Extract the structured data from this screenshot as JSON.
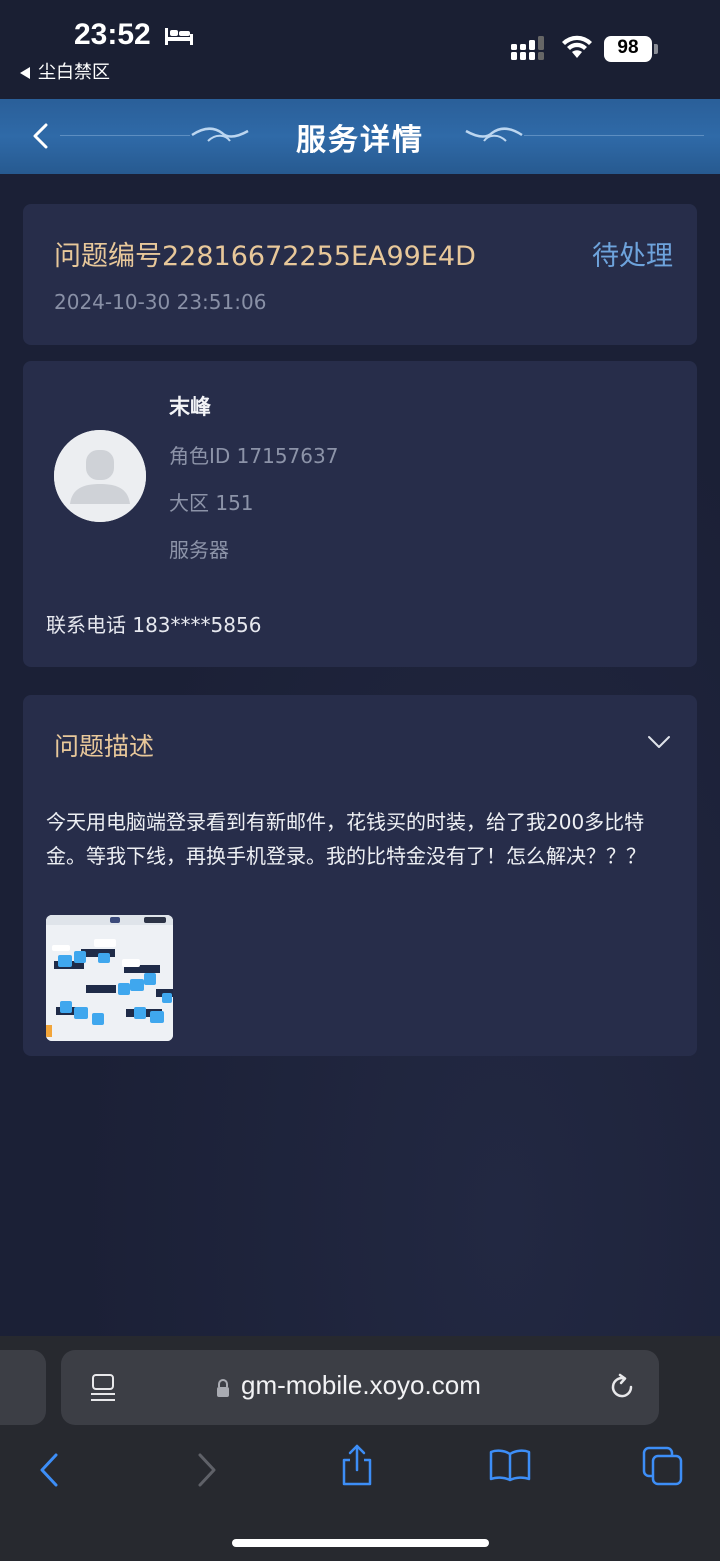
{
  "status_bar": {
    "time": "23:52",
    "back_app": "尘白禁区",
    "battery": "98",
    "icons": [
      "bed-icon",
      "signal-icon",
      "wifi-icon",
      "battery-icon"
    ]
  },
  "header": {
    "title": "服务详情",
    "back_icon": "chevron-left-icon"
  },
  "ticket": {
    "number_label": "问题编号22816672255EA99E4D",
    "status": "待处理",
    "time": "2024-10-30 23:51:06"
  },
  "user": {
    "name": "末峰",
    "role_id": "角色ID 17157637",
    "region": "大区 151",
    "server": "服务器",
    "phone": "联系电话 183****5856"
  },
  "description": {
    "title": "问题描述",
    "text": "今天用电脑端登录看到有新邮件，花钱买的时装，给了我200多比特金。等我下线，再换手机登录。我的比特金没有了！怎么解决？？？"
  },
  "browser": {
    "url": "gm-mobile.xoyo.com"
  },
  "colors": {
    "background": "#1b2036",
    "card": "#272d4a",
    "gold_text": "#e8c89a",
    "status_blue": "#6ea3dc",
    "header_blue": "#2f6aa8"
  }
}
